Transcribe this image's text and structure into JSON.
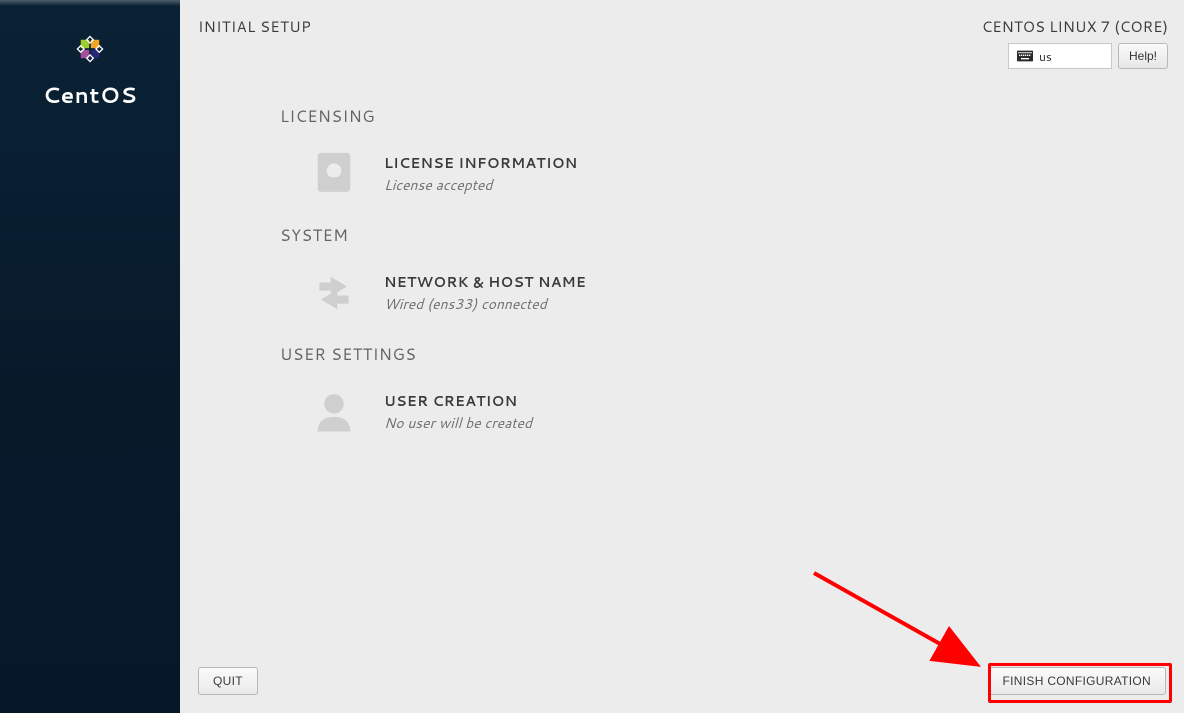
{
  "sidebar": {
    "product_name": "CentOS"
  },
  "header": {
    "title": "INITIAL SETUP",
    "distro": "CENTOS LINUX 7 (CORE)",
    "keyboard_layout": "us",
    "help_label": "Help!"
  },
  "sections": {
    "licensing": {
      "heading": "LICENSING",
      "spoke_title": "LICENSE INFORMATION",
      "spoke_status": "License accepted"
    },
    "system": {
      "heading": "SYSTEM",
      "spoke_title": "NETWORK & HOST NAME",
      "spoke_status": "Wired (ens33) connected"
    },
    "user": {
      "heading": "USER SETTINGS",
      "spoke_title": "USER CREATION",
      "spoke_status": "No user will be created"
    }
  },
  "footer": {
    "quit_label": "QUIT",
    "finish_label": "FINISH CONFIGURATION"
  }
}
